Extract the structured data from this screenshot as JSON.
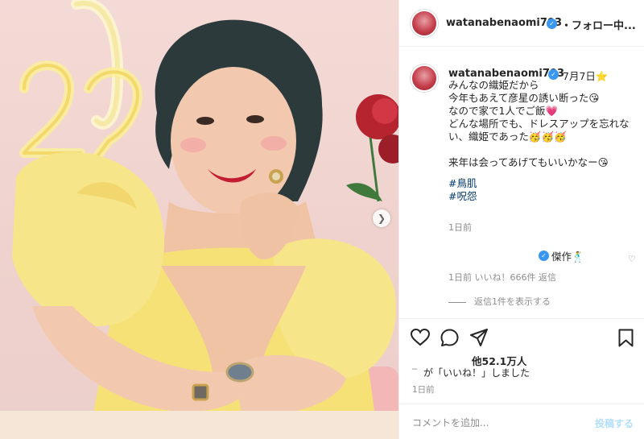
{
  "post": {
    "username": "watanabenaomi703",
    "follow_status": "・フォロー中...",
    "caption": {
      "date": "7月7日⭐",
      "lines": [
        "みんなの織姫だから",
        "今年もあえて彦星の誘い断った😘",
        "なので家で1人でご飯💗",
        "どんな場所でも、ドレスアップを忘れない、織姫であった🥳🥳🥳",
        "",
        "来年は会ってあげてもいいかなー😘"
      ],
      "hashtags": [
        "#鳥肌",
        "#呪怨"
      ],
      "time_ago": "1日前"
    },
    "comment": {
      "text": "傑作🕺",
      "meta": "1日前   いいね！666件   返信",
      "view_replies": "返信1件を表示する"
    },
    "likes_label": "他52.1万人",
    "liked_by_suffix": "が「いいね！」しました",
    "post_time": "1日前",
    "comment_placeholder": "コメントを追加...",
    "post_button": "投稿する"
  },
  "colors": {
    "verified": "#3897f0",
    "link": "#00376b",
    "muted": "#8e8e8e",
    "post_button_disabled": "#b2dffc"
  },
  "icons": [
    "verified-badge-icon",
    "heart-icon",
    "comment-icon",
    "share-icon",
    "bookmark-icon",
    "small-heart-icon",
    "next-arrow-icon"
  ]
}
